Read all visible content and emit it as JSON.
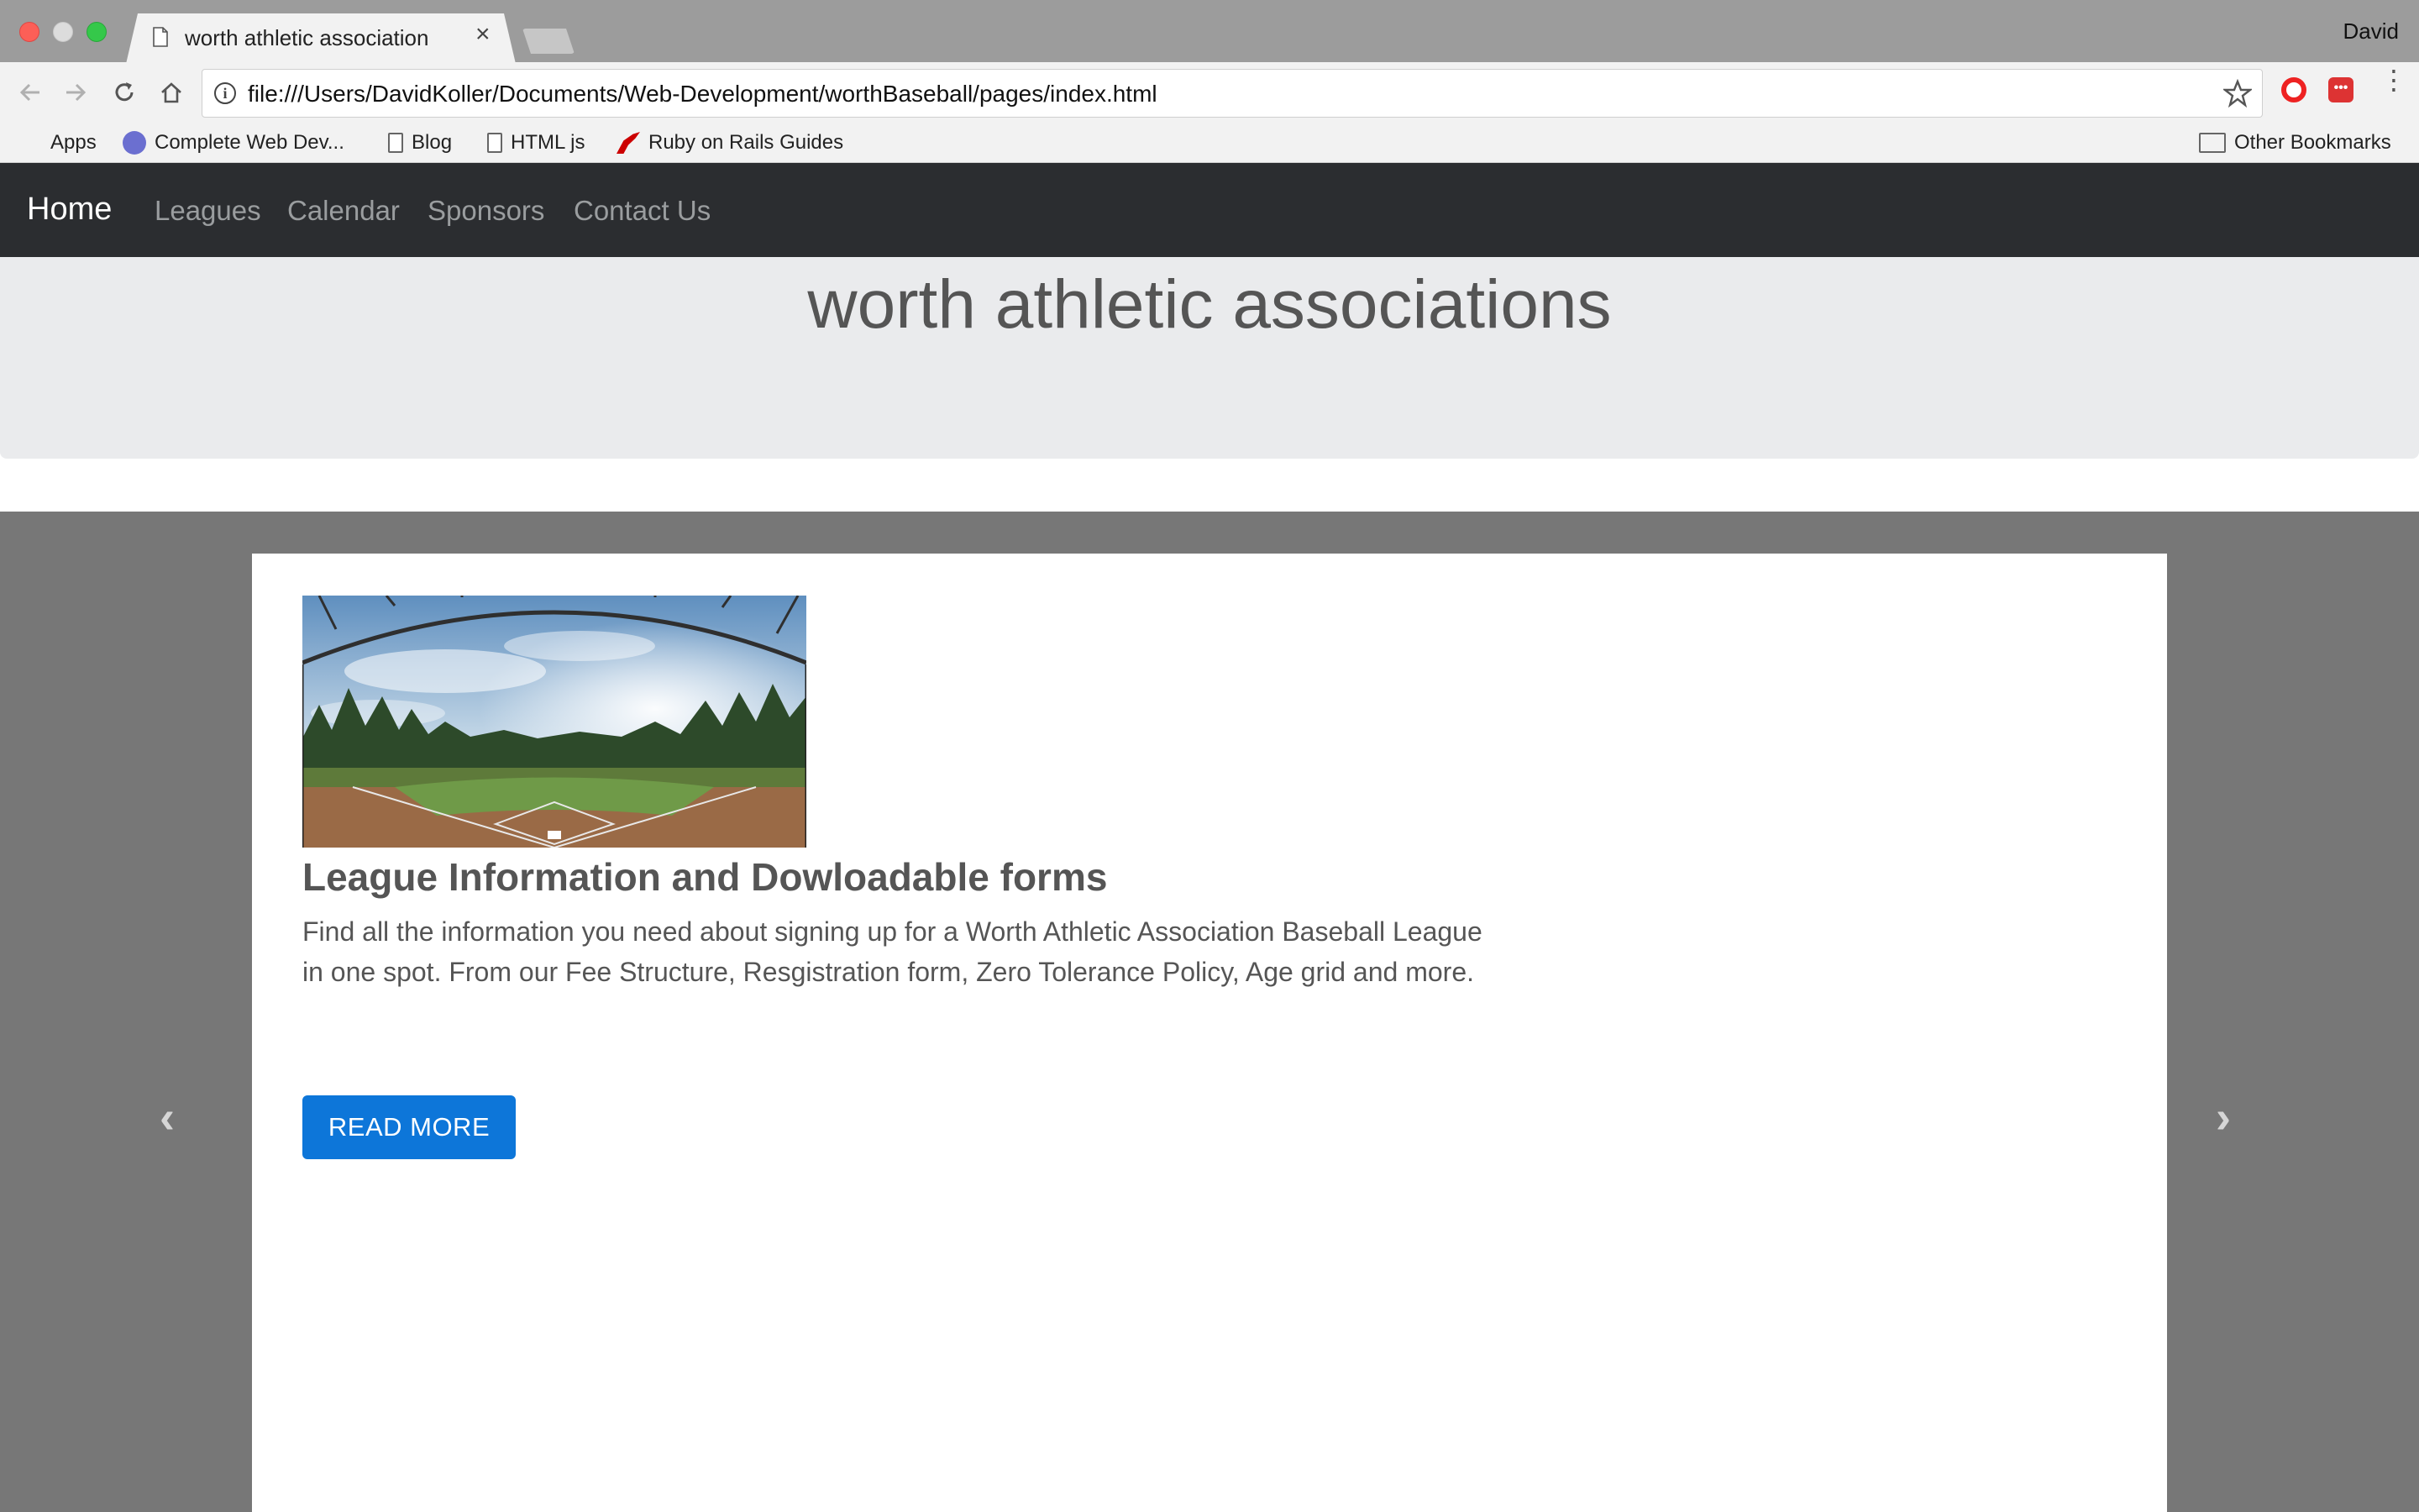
{
  "browser": {
    "tab_title": "worth athletic association",
    "tab_close": "×",
    "profile_name": "David",
    "url": "file:///Users/DavidKoller/Documents/Web-Development/worthBaseball/pages/index.html",
    "bookmarks": [
      {
        "label": "Apps",
        "icon": "apps-grid-icon"
      },
      {
        "label": "Complete Web Dev...",
        "icon": "site-icon"
      },
      {
        "label": "Blog",
        "icon": "page-icon"
      },
      {
        "label": "HTML js",
        "icon": "page-icon"
      },
      {
        "label": "Ruby on Rails Guides",
        "icon": "rails-icon"
      }
    ],
    "other_bookmarks": "Other Bookmarks"
  },
  "navbar": {
    "brand": "Home",
    "links": [
      "Leagues",
      "Calendar",
      "Sponsors",
      "Contact Us"
    ]
  },
  "jumbotron": {
    "title": "worth athletic associations"
  },
  "carousel": {
    "card_title": "League Information and Dowloadable forms",
    "card_text": "Find all the information you need about signing up for a Worth Athletic Association Baseball League in one spot. From our Fee Structure, Resgistration form, Zero Tolerance Policy, Age grid and more.",
    "button_label": "READ MORE",
    "prev_icon": "‹",
    "next_icon": "›"
  },
  "colors": {
    "navbar_bg": "#2b2d30",
    "jumbotron_bg": "#eaebed",
    "carousel_bg": "#777777",
    "button_bg": "#0d76d9"
  }
}
